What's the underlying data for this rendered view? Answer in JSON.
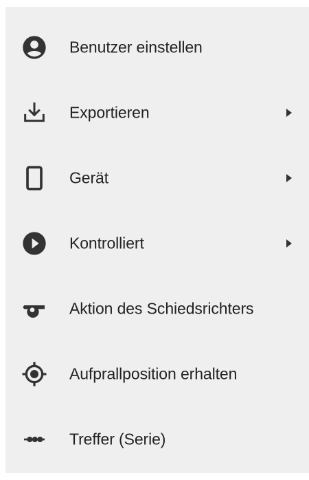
{
  "menu": {
    "items": [
      {
        "label": "Benutzer einstellen",
        "icon": "account-circle-icon",
        "has_submenu": false
      },
      {
        "label": "Exportieren",
        "icon": "download-icon",
        "has_submenu": true
      },
      {
        "label": "Gerät",
        "icon": "smartphone-icon",
        "has_submenu": true
      },
      {
        "label": "Kontrolliert",
        "icon": "play-circle-icon",
        "has_submenu": true
      },
      {
        "label": "Aktion des Schiedsrichters",
        "icon": "whistle-icon",
        "has_submenu": false
      },
      {
        "label": "Aufprallposition erhalten",
        "icon": "crosshair-icon",
        "has_submenu": false
      },
      {
        "label": "Treffer (Serie)",
        "icon": "dotted-line-icon",
        "has_submenu": false
      }
    ]
  },
  "colors": {
    "menu_background": "#efefef",
    "icon": "#333333",
    "text": "#222222"
  }
}
